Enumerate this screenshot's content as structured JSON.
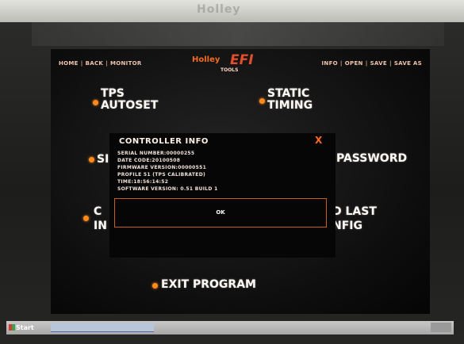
{
  "bezel": {
    "brand": "Holley"
  },
  "nav_left": [
    "HOME",
    "BACK",
    "MONITOR"
  ],
  "nav_right": [
    "INFO",
    "OPEN",
    "SAVE",
    "SAVE AS"
  ],
  "logo": {
    "name": "Holley",
    "efi": "EFI",
    "tools": "TOOLS"
  },
  "menu": {
    "tps_autoset": "TPS AUTOSET",
    "static_timing": "STATIC TIMING",
    "password": "PASSWORD",
    "load_last_config": "LOAD LAST CONFIG",
    "exit_program": "EXIT PROGRAM",
    "partial_si": "SI",
    "partial_c": "C",
    "partial_in": "IN",
    "partial_d_last": "D LAST",
    "partial_nfig": "NFIG"
  },
  "dialog": {
    "title": "CONTROLLER INFO",
    "close_glyph": "X",
    "lines": [
      "SERIAL NUMBER:00000255",
      "DATE CODE:20100508",
      "FIRMWARE VERSION:00000551",
      "PROFILE 51 (TPS CALIBRATED)",
      "TIME:18:56:14:52",
      "SOFTWARE VERSION: 0.51 BUILD 1"
    ],
    "ok_label": "OK"
  },
  "taskbar": {
    "start_label": "Start"
  },
  "colors": {
    "accent": "#ff8a1e",
    "screen_bg": "#0d0d0d",
    "text": "#fffaf4"
  }
}
